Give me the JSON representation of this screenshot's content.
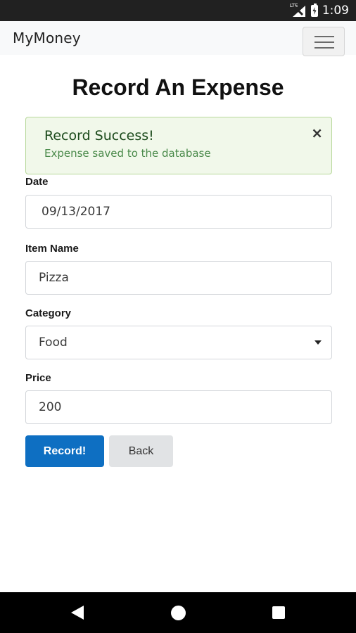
{
  "status_bar": {
    "network": "LTE",
    "time": "1:09"
  },
  "navbar": {
    "brand": "MyMoney"
  },
  "page": {
    "title": "Record An Expense"
  },
  "alert": {
    "title": "Record Success!",
    "message": "Expense saved to the database",
    "close_symbol": "×"
  },
  "form": {
    "date": {
      "label": "Date",
      "value": "09/13/2017"
    },
    "item_name": {
      "label": "Item Name",
      "value": "Pizza"
    },
    "category": {
      "label": "Category",
      "value": "Food"
    },
    "price": {
      "label": "Price",
      "value": "200"
    }
  },
  "buttons": {
    "record": "Record!",
    "back": "Back"
  },
  "colors": {
    "primary": "#0e6fc2",
    "alert_bg": "#f1f8ea",
    "alert_border": "#b7d89a",
    "navbar_bg": "#f8f9fa"
  },
  "icons": {
    "status": [
      "lte-signal-icon",
      "battery-icon"
    ],
    "nav": [
      "back-icon",
      "home-icon",
      "recents-icon"
    ],
    "menu": "hamburger-menu-icon"
  }
}
